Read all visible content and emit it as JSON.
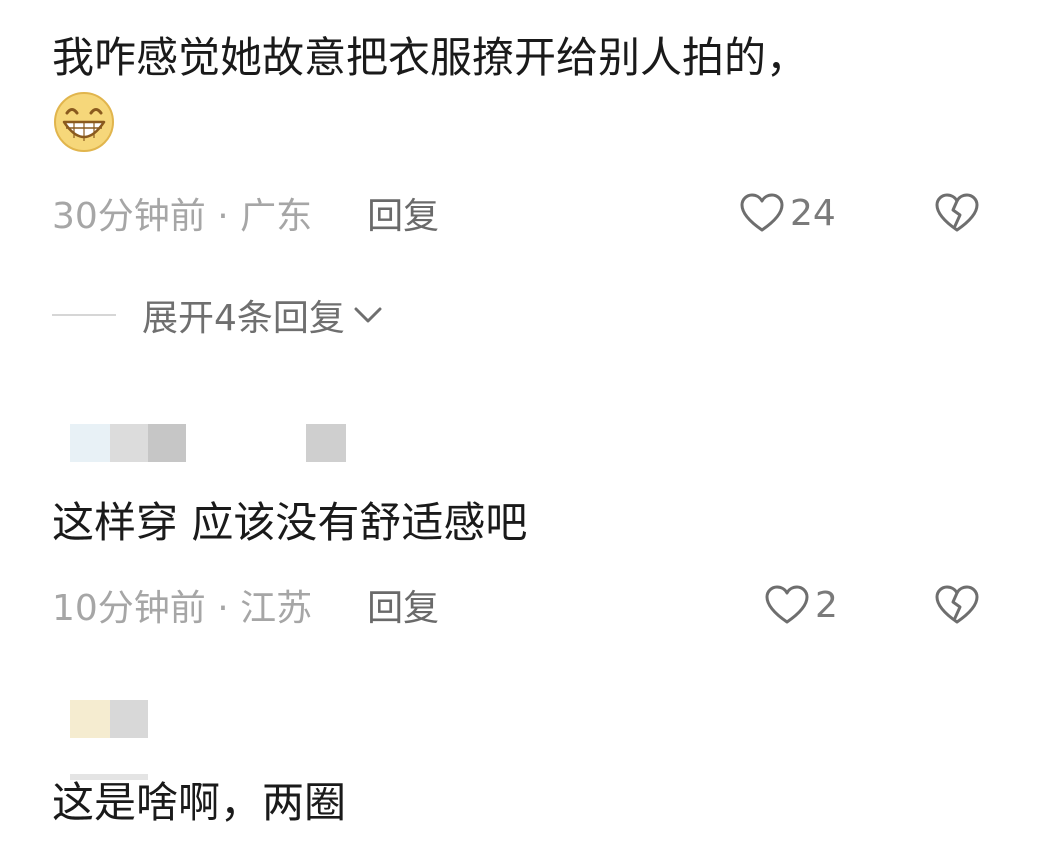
{
  "comments": [
    {
      "text": "我咋感觉她故意把衣服撩开给别人拍的，",
      "time": "30分钟前 · 广东",
      "reply_label": "回复",
      "likes": "24",
      "emoji": "grinning-face-icon"
    },
    {
      "text": "这样穿 应该没有舒适感吧",
      "time": "10分钟前 · 江苏",
      "reply_label": "回复",
      "likes": "2"
    },
    {
      "text": "这是啥啊，两圈"
    }
  ],
  "expand_replies": {
    "label": "展开4条回复",
    "icon": "chevron-down-icon"
  },
  "colors": {
    "meta": "#a6a6a6",
    "reply": "#6a6a6a",
    "icon": "#6e6e6e",
    "emoji_yellow": "#f4cf6b"
  }
}
